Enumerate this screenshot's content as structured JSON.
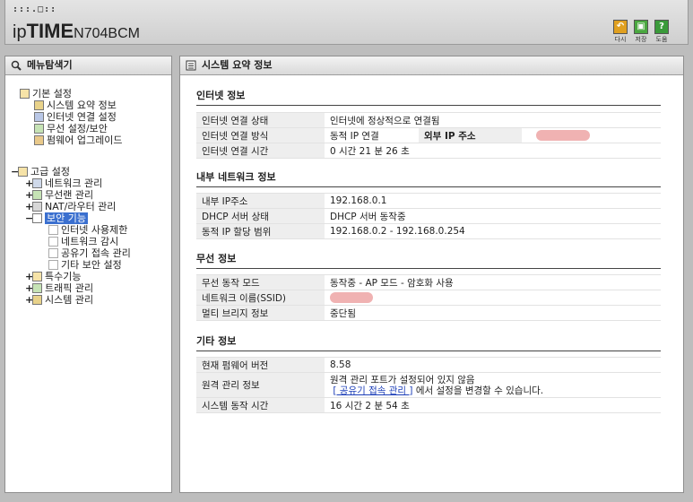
{
  "header": {
    "logo_dots": ":::.□::",
    "logo_ip": "ip",
    "logo_time": "TIME",
    "logo_model": "N704BCM",
    "buttons": [
      {
        "label": "다시",
        "icon": "undo-icon",
        "color": "#e0a020"
      },
      {
        "label": "저장",
        "icon": "save-icon",
        "color": "#4aa840"
      },
      {
        "label": "도움",
        "icon": "help-icon",
        "color": "#3a9a3a"
      }
    ]
  },
  "sidebar": {
    "title": "메뉴탐색기",
    "basic": {
      "label": "기본 설정",
      "items": [
        "시스템 요약 정보",
        "인터넷 연결 설정",
        "무선 설정/보안",
        "펌웨어 업그레이드"
      ]
    },
    "advanced": {
      "label": "고급 설정",
      "items": [
        "네트워크 관리",
        "무선랜 관리",
        "NAT/라우터 관리",
        "보안 기능"
      ],
      "security_children": [
        "인터넷 사용제한",
        "네트워크 감시",
        "공유기 접속 관리",
        "기타 보안 설정"
      ],
      "after": [
        "특수기능",
        "트래픽 관리",
        "시스템 관리"
      ]
    }
  },
  "main": {
    "title": "시스템 요약 정보",
    "internet": {
      "heading": "인터넷 정보",
      "rows": [
        {
          "k": "인터넷 연결 상태",
          "v": "인터넷에 정상적으로 연결됨"
        },
        {
          "k": "인터넷 연결 방식",
          "v": "동적 IP 연결",
          "k2": "외부 IP 주소"
        },
        {
          "k": "인터넷 연결 시간",
          "v": "0 시간 21 분 26 초"
        }
      ]
    },
    "lan": {
      "heading": "내부 네트워크 정보",
      "rows": [
        {
          "k": "내부 IP주소",
          "v": "192.168.0.1"
        },
        {
          "k": "DHCP 서버 상태",
          "v": "DHCP 서버 동작중"
        },
        {
          "k": "동적 IP 할당 범위",
          "v": "192.168.0.2 -  192.168.0.254"
        }
      ]
    },
    "wireless": {
      "heading": "무선 정보",
      "rows": [
        {
          "k": "무선 동작 모드",
          "v": "동작중 - AP 모드 - 암호화 사용"
        },
        {
          "k": "네트워크 이름(SSID)",
          "v": ""
        },
        {
          "k": "멀티 브리지 정보",
          "v": "중단됨"
        }
      ]
    },
    "other": {
      "heading": "기타 정보",
      "rows": [
        {
          "k": "현재 펌웨어 버전",
          "v": "8.58"
        },
        {
          "k": "원격 관리 정보",
          "v_line1": "원격 관리 포트가 설정되어 있지 않음",
          "v_link": "[ 공유기 접속 관리 ]",
          "v_line2": "에서 설정을 변경할 수 있습니다."
        },
        {
          "k": "시스템 동작 시간",
          "v": "16 시간 2 분 54 초"
        }
      ]
    }
  }
}
